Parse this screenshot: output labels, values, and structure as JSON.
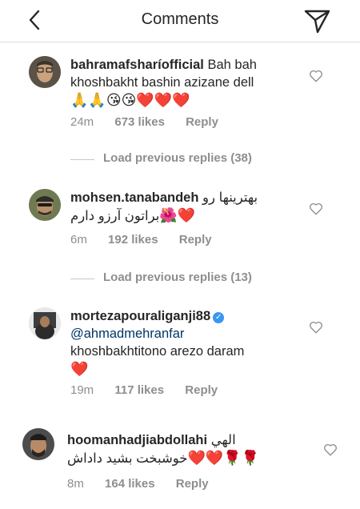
{
  "header": {
    "title": "Comments"
  },
  "comments": [
    {
      "username": "bahramafsharíofficial",
      "text": "Bah bah khoshbakht bashin azizane dell",
      "time": "24m",
      "likes": "673 likes",
      "reply": "Reply"
    },
    {
      "username": "mohsen.tanabandeh",
      "text_rtl": "بهترینها رو",
      "text2_rtl": "براتون آرزو دارم",
      "time": "6m",
      "likes": "192 likes",
      "reply": "Reply"
    },
    {
      "username": "mortezapouraliganji88",
      "mention": "@ahmadmehranfar",
      "text": "khoshbakhtitono arezo daram",
      "time": "19m",
      "likes": "117 likes",
      "reply": "Reply"
    },
    {
      "username": "hoomanhadjiabdollahi",
      "text_rtl": "الهي",
      "text2_rtl": "خوشبخت بشيد داداش",
      "time": "8m",
      "likes": "164 likes",
      "reply": "Reply"
    }
  ],
  "load_previous": [
    {
      "label": "Load previous replies (38)"
    },
    {
      "label": "Load previous replies (13)"
    }
  ],
  "colors": {
    "text": "#262626",
    "meta": "#8e8e8e",
    "mention": "#003569",
    "verified": "#3897f0",
    "heart": "#e8202c",
    "divider": "#dbdbdb"
  },
  "icons": [
    "back-arrow-icon",
    "send-direct-icon",
    "heart-outline-icon",
    "verified-badge-icon"
  ]
}
